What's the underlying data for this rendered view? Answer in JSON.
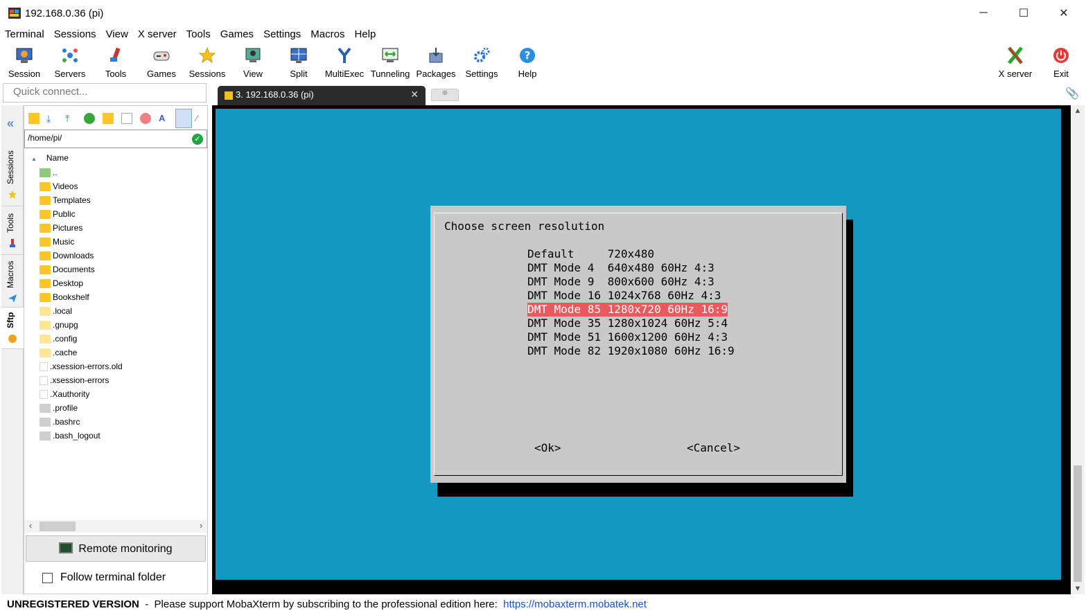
{
  "window": {
    "title": "192.168.0.36 (pi)",
    "minimize": "─",
    "maximize": "☐",
    "close": "✕"
  },
  "menu": [
    "Terminal",
    "Sessions",
    "View",
    "X server",
    "Tools",
    "Games",
    "Settings",
    "Macros",
    "Help"
  ],
  "toolbar": {
    "session": "Session",
    "servers": "Servers",
    "tools": "Tools",
    "games": "Games",
    "sessions": "Sessions",
    "view": "View",
    "split": "Split",
    "multiexec": "MultiExec",
    "tunneling": "Tunneling",
    "packages": "Packages",
    "settings": "Settings",
    "help": "Help",
    "xserver": "X server",
    "exit": "Exit"
  },
  "quick_connect": {
    "placeholder": "Quick connect..."
  },
  "tab": {
    "label": "3. 192.168.0.36 (pi)",
    "close": "✕",
    "new_tab_glyph": "⊕"
  },
  "side_tabs": {
    "sessions": "Sessions",
    "tools": "Tools",
    "macros": "Macros",
    "sftp": "Sftp"
  },
  "sftp": {
    "path": "/home/pi/",
    "column_name": "Name",
    "files": [
      {
        "name": "..",
        "kind": "parent"
      },
      {
        "name": "Videos",
        "kind": "folder"
      },
      {
        "name": "Templates",
        "kind": "folder"
      },
      {
        "name": "Public",
        "kind": "folder"
      },
      {
        "name": "Pictures",
        "kind": "folder"
      },
      {
        "name": "Music",
        "kind": "folder"
      },
      {
        "name": "Downloads",
        "kind": "folder"
      },
      {
        "name": "Documents",
        "kind": "folder"
      },
      {
        "name": "Desktop",
        "kind": "folder"
      },
      {
        "name": "Bookshelf",
        "kind": "folder"
      },
      {
        "name": ".local",
        "kind": "hidden-folder"
      },
      {
        "name": ".gnupg",
        "kind": "hidden-folder"
      },
      {
        "name": ".config",
        "kind": "hidden-folder"
      },
      {
        "name": ".cache",
        "kind": "hidden-folder"
      },
      {
        "name": ".xsession-errors.old",
        "kind": "file"
      },
      {
        "name": ".xsession-errors",
        "kind": "file"
      },
      {
        "name": ".Xauthority",
        "kind": "file"
      },
      {
        "name": ".profile",
        "kind": "config"
      },
      {
        "name": ".bashrc",
        "kind": "config"
      },
      {
        "name": ".bash_logout",
        "kind": "config"
      }
    ],
    "remote_monitoring": "Remote monitoring",
    "follow_folder": "Follow terminal folder",
    "follow_folder_checked": false
  },
  "dialog": {
    "title": "Choose screen resolution",
    "options": [
      {
        "text": "Default     720x480",
        "selected": false
      },
      {
        "text": "DMT Mode 4  640x480 60Hz 4:3",
        "selected": false
      },
      {
        "text": "DMT Mode 9  800x600 60Hz 4:3",
        "selected": false
      },
      {
        "text": "DMT Mode 16 1024x768 60Hz 4:3",
        "selected": false
      },
      {
        "text": "DMT Mode 85 1280x720 60Hz 16:9",
        "selected": true
      },
      {
        "text": "DMT Mode 35 1280x1024 60Hz 5:4",
        "selected": false
      },
      {
        "text": "DMT Mode 51 1600x1200 60Hz 4:3",
        "selected": false
      },
      {
        "text": "DMT Mode 82 1920x1080 60Hz 16:9",
        "selected": false
      }
    ],
    "ok": "<Ok>",
    "cancel": "<Cancel>"
  },
  "statusbar": {
    "unregistered": "UNREGISTERED VERSION",
    "message": "  -  Please support MobaXterm by subscribing to the professional edition here:  ",
    "link": "https://mobaxterm.mobatek.net"
  },
  "colors": {
    "terminal_bg": "#1497c0",
    "dialog_bg": "#c9c9c9",
    "selection": "#e95a5e",
    "folder": "#ffc629"
  }
}
